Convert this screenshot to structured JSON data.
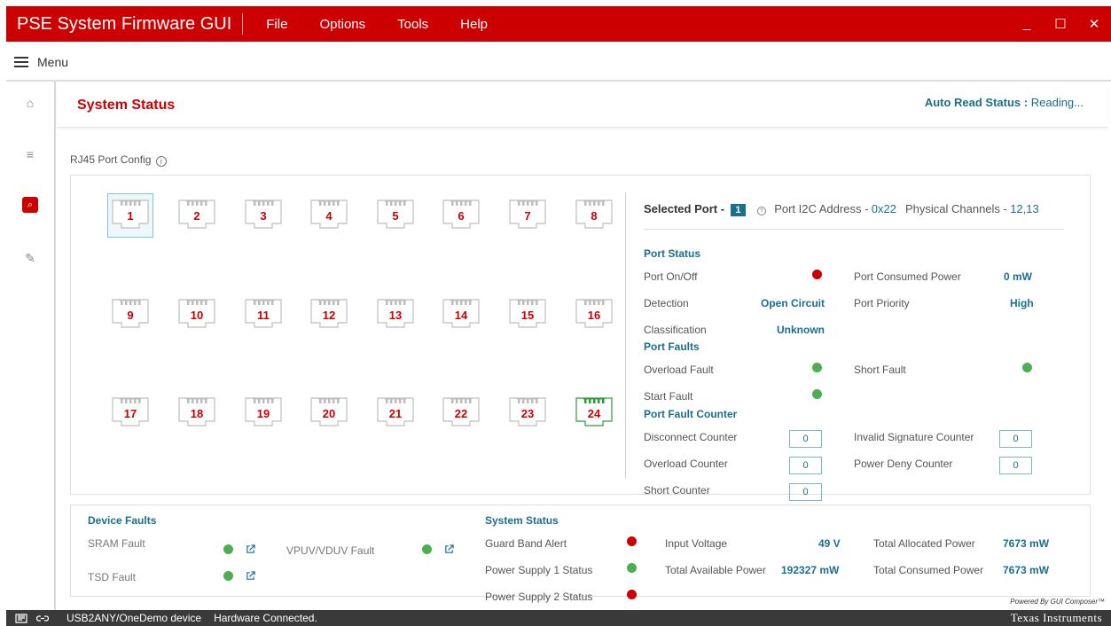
{
  "titlebar": {
    "app_title": "PSE System Firmware GUI",
    "menus": [
      "File",
      "Options",
      "Tools",
      "Help"
    ],
    "controls": [
      "_",
      "☐",
      "✕"
    ]
  },
  "menubar": {
    "label": "Menu"
  },
  "sidebar": {
    "items": [
      {
        "icon": "home-icon",
        "glyph": "⌂"
      },
      {
        "icon": "sliders-icon",
        "glyph": "≡"
      },
      {
        "icon": "search-icon",
        "glyph": "⌕",
        "active": true
      },
      {
        "icon": "edit-icon",
        "glyph": "✎"
      }
    ]
  },
  "page": {
    "title": "System Status",
    "auto_read_label": "Auto Read Status :",
    "auto_read_value": "Reading...",
    "section_label": "RJ45 Port Config"
  },
  "ports": {
    "rows": [
      [
        "1",
        "2",
        "3",
        "4",
        "5",
        "6",
        "7",
        "8"
      ],
      [
        "9",
        "10",
        "11",
        "12",
        "13",
        "14",
        "15",
        "16"
      ],
      [
        "17",
        "18",
        "19",
        "20",
        "21",
        "22",
        "23",
        "24"
      ]
    ],
    "selected": "1",
    "active": "24"
  },
  "selected_port": {
    "label": "Selected Port -",
    "value": "1",
    "i2c_label": "Port I2C Address -",
    "i2c_value": "0x22",
    "channels_label": "Physical Channels -",
    "channels_value": "12,13"
  },
  "port_status": {
    "heading": "Port Status",
    "on_off_label": "Port On/Off",
    "on_off_state": "red",
    "consumed_power_label": "Port Consumed Power",
    "consumed_power_value": "0 mW",
    "detection_label": "Detection",
    "detection_value": "Open Circuit",
    "priority_label": "Port Priority",
    "priority_value": "High",
    "classification_label": "Classification",
    "classification_value": "Unknown"
  },
  "port_faults": {
    "heading": "Port Faults",
    "overload_label": "Overload Fault",
    "overload_state": "green",
    "short_label": "Short Fault",
    "short_state": "green",
    "start_label": "Start Fault",
    "start_state": "green"
  },
  "fault_counter": {
    "heading": "Port Fault Counter",
    "disconnect_label": "Disconnect Counter",
    "disconnect_value": "0",
    "invalid_sig_label": "Invalid Signature Counter",
    "invalid_sig_value": "0",
    "overload_label": "Overload Counter",
    "overload_value": "0",
    "power_deny_label": "Power Deny Counter",
    "power_deny_value": "0",
    "short_label": "Short Counter",
    "short_value": "0"
  },
  "device_faults": {
    "heading": "Device Faults",
    "sram_label": "SRAM Fault",
    "sram_state": "green",
    "vpuv_label": "VPUV/VDUV Fault",
    "vpuv_state": "green",
    "tsd_label": "TSD Fault",
    "tsd_state": "green"
  },
  "system_status": {
    "heading": "System Status",
    "guard_band_label": "Guard Band Alert",
    "guard_band_state": "red",
    "ps1_label": "Power Supply 1 Status",
    "ps1_state": "green",
    "ps2_label": "Power Supply 2 Status",
    "ps2_state": "red",
    "input_voltage_label": "Input Voltage",
    "input_voltage_value": "49 V",
    "total_available_label": "Total Available Power",
    "total_available_value": "192327 mW",
    "total_allocated_label": "Total Allocated Power",
    "total_allocated_value": "7673 mW",
    "total_consumed_label": "Total Consumed Power",
    "total_consumed_value": "7673 mW"
  },
  "footer": {
    "powered_by": "Powered By GUI Composer™",
    "device": "USB2ANY/OneDemo device",
    "connection": "Hardware Connected.",
    "vendor": "Texas Instruments"
  },
  "colors": {
    "brand_red": "#cc0000",
    "link_teal": "#1a6f8c",
    "status_green": "#4caf50",
    "status_red": "#cc0000"
  }
}
